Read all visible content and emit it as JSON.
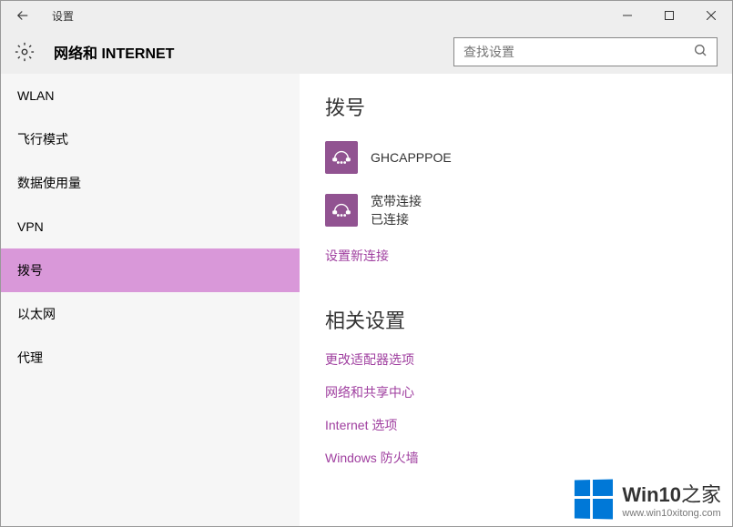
{
  "window": {
    "title": "设置"
  },
  "header": {
    "page_title": "网络和 INTERNET",
    "search_placeholder": "查找设置"
  },
  "sidebar": {
    "items": [
      {
        "label": "WLAN"
      },
      {
        "label": "飞行模式"
      },
      {
        "label": "数据使用量"
      },
      {
        "label": "VPN"
      },
      {
        "label": "拨号"
      },
      {
        "label": "以太网"
      },
      {
        "label": "代理"
      }
    ],
    "selected_index": 4
  },
  "main": {
    "title": "拨号",
    "connections": [
      {
        "name": "GHCAPPPOE",
        "status": ""
      },
      {
        "name": "宽带连接",
        "status": "已连接"
      }
    ],
    "new_connection_link": "设置新连接"
  },
  "related": {
    "title": "相关设置",
    "links": [
      "更改适配器选项",
      "网络和共享中心",
      "Internet 选项",
      "Windows 防火墙"
    ]
  },
  "watermark": {
    "brand_html": "Win10",
    "suffix": "之家",
    "url": "www.win10xitong.com"
  }
}
